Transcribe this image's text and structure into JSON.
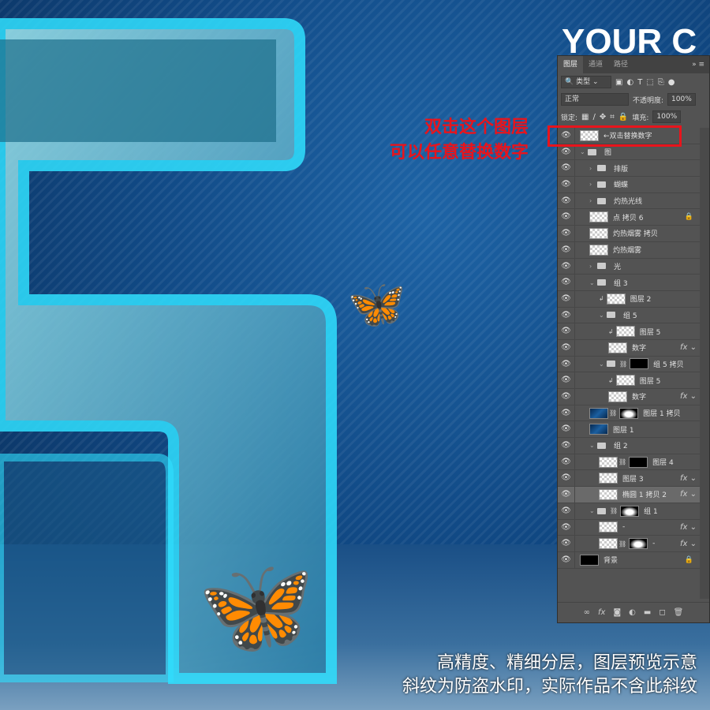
{
  "poster": {
    "title_partial": "YOUR C",
    "annotation_lines": [
      "双击这个图层",
      "可以任意替换数字"
    ],
    "footer_lines": [
      "高精度、精细分层，图层预览示意",
      "斜纹为防盗水印，实际作品不含此斜纹"
    ],
    "accent": "#e8141c"
  },
  "panel": {
    "tabs": [
      "图层",
      "通道",
      "路径"
    ],
    "filter_kind": "类型",
    "blend_mode": "正常",
    "opacity_label": "不透明度:",
    "opacity_value": "100%",
    "lock_label": "锁定:",
    "fill_label": "填充:",
    "fill_value": "100%",
    "layers": [
      {
        "name": "←双击替换数字",
        "type": "smart",
        "indent": 0
      },
      {
        "name": "图",
        "type": "group-open",
        "indent": 0
      },
      {
        "name": "排版",
        "type": "group",
        "indent": 1
      },
      {
        "name": "蝴蝶",
        "type": "group",
        "indent": 1
      },
      {
        "name": "灼热光线",
        "type": "group",
        "indent": 1
      },
      {
        "name": "点 拷贝 6",
        "type": "layer",
        "indent": 1,
        "locked": true
      },
      {
        "name": "灼热烟雾 拷贝",
        "type": "layer",
        "indent": 1
      },
      {
        "name": "灼热烟雾",
        "type": "layer",
        "indent": 1
      },
      {
        "name": "光",
        "type": "group",
        "indent": 1
      },
      {
        "name": "组 3",
        "type": "group-open",
        "indent": 1
      },
      {
        "name": "图层 2",
        "type": "layer",
        "indent": 2,
        "clip": true
      },
      {
        "name": "组 5",
        "type": "group-open",
        "indent": 2
      },
      {
        "name": "图层 5",
        "type": "layer",
        "indent": 3,
        "clip": true
      },
      {
        "name": "数字",
        "type": "smart",
        "indent": 3,
        "fx": true
      },
      {
        "name": "组 5 拷贝",
        "type": "group-open",
        "indent": 2,
        "mask": "bar"
      },
      {
        "name": "图层 5",
        "type": "layer",
        "indent": 3,
        "clip": true
      },
      {
        "name": "数字",
        "type": "smart",
        "indent": 3,
        "fx": true
      },
      {
        "name": "图层 1 拷贝",
        "type": "blue",
        "indent": 1,
        "mask": "glow"
      },
      {
        "name": "图层 1",
        "type": "blue",
        "indent": 1
      },
      {
        "name": "组 2",
        "type": "group-open",
        "indent": 1
      },
      {
        "name": "图层 4",
        "type": "layer",
        "indent": 2,
        "mask": "bar"
      },
      {
        "name": "图层 3",
        "type": "layer",
        "indent": 2,
        "fx": true
      },
      {
        "name": "椭圆 1 拷贝 2",
        "type": "layer",
        "indent": 2,
        "fx": true,
        "selected": true
      },
      {
        "name": "组 1",
        "type": "group-open",
        "indent": 1,
        "mask": "glow"
      },
      {
        "name": "-",
        "type": "layer",
        "indent": 2,
        "fx": true
      },
      {
        "name": "-",
        "type": "layer",
        "indent": 2,
        "fx": true,
        "mask": "glow"
      },
      {
        "name": "背景",
        "type": "dark",
        "indent": 0,
        "locked": true
      }
    ],
    "icons": {
      "eye": "eye-icon",
      "fx": "fx-icon",
      "lock": "lock-icon",
      "folder": "folder-icon"
    }
  }
}
